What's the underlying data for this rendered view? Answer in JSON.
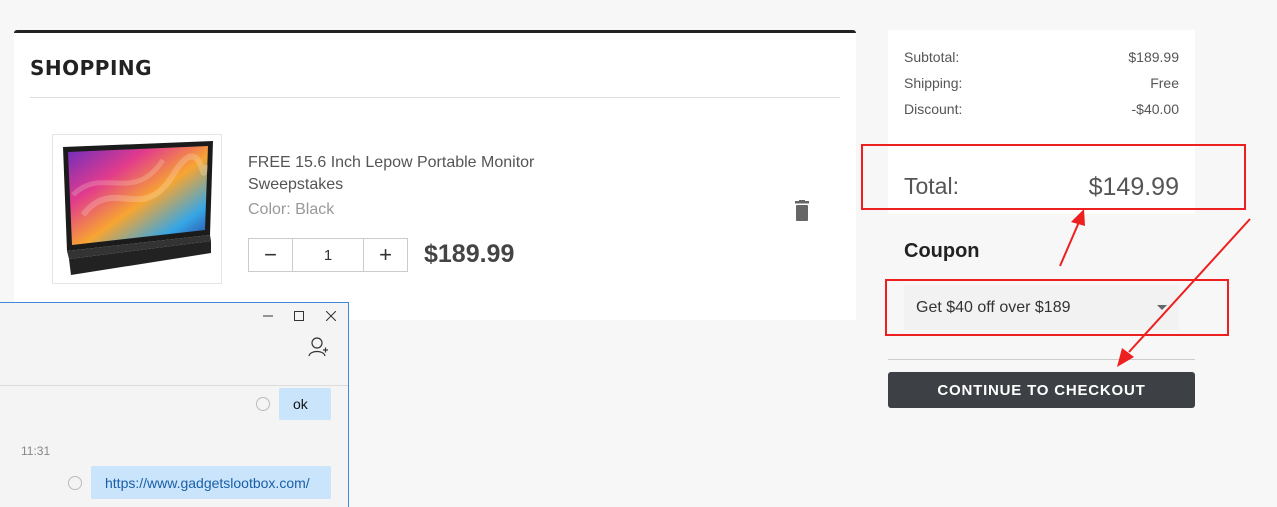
{
  "cart": {
    "title": "SHOPPING",
    "item": {
      "name": "FREE 15.6 Inch Lepow Portable Monitor Sweepstakes",
      "color_label": "Color: Black",
      "quantity": "1",
      "minus": "−",
      "plus": "+",
      "price": "$189.99"
    }
  },
  "summary": {
    "subtotal_label": "Subtotal:",
    "subtotal_value": "$189.99",
    "shipping_label": "Shipping:",
    "shipping_value": "Free",
    "discount_label": "Discount:",
    "discount_value": "-$40.00",
    "total_label": "Total:",
    "total_value": "$149.99"
  },
  "coupon": {
    "title": "Coupon",
    "selected": "Get $40 off over $189"
  },
  "checkout_label": "CONTINUE TO CHECKOUT",
  "chat": {
    "msg1": "ok",
    "time": "11:31",
    "msg2": "https://www.gadgetslootbox.com/"
  },
  "colors": {
    "highlight": "#ee1f1f",
    "checkout_bg": "#3d4145",
    "bubble_bg": "#c9e4fb"
  }
}
